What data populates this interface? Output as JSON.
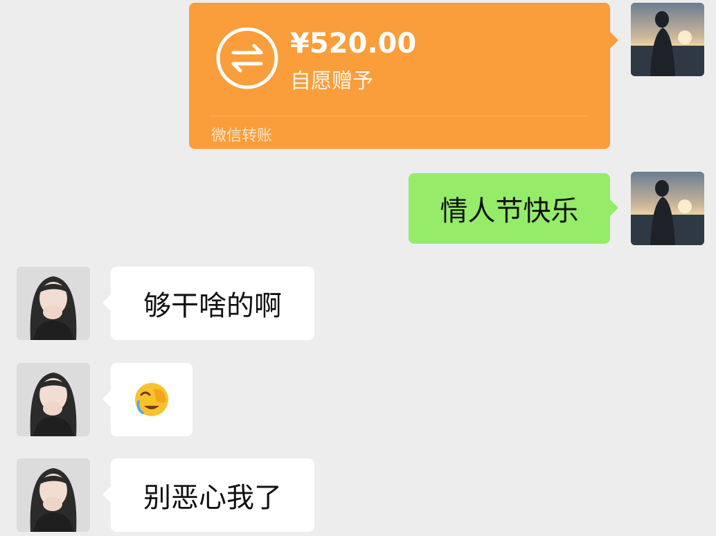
{
  "chat": {
    "messages": [
      {
        "type": "transfer",
        "direction": "outgoing",
        "amount": "¥520.00",
        "note": "自愿赠予",
        "source_label": "微信转账",
        "icon": "transfer-arrows-icon",
        "bubble_color": "#fa9d3b"
      },
      {
        "type": "text",
        "direction": "outgoing",
        "text": "情人节快乐",
        "bubble_color": "#95ec69"
      },
      {
        "type": "text",
        "direction": "incoming",
        "text": "够干啥的啊",
        "bubble_color": "#ffffff"
      },
      {
        "type": "emoji",
        "direction": "incoming",
        "emoji": "facepalm-emoji-icon",
        "bubble_color": "#ffffff"
      },
      {
        "type": "text",
        "direction": "incoming",
        "text": "别恶心我了",
        "bubble_color": "#ffffff"
      }
    ]
  }
}
